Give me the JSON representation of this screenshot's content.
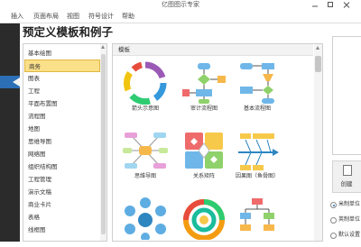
{
  "app_title": "亿图图示专家",
  "menu": [
    "插入",
    "页面布局",
    "视图",
    "符号设计",
    "帮助"
  ],
  "heading": "预定义模板和例子",
  "categories": {
    "items": [
      "基本绘图",
      "商务",
      "图表",
      "工程",
      "平面布置图",
      "流程图",
      "地图",
      "思维导图",
      "网络图",
      "组织结构图",
      "工程管理",
      "演示文稿",
      "商业卡片",
      "表格",
      "线框图"
    ],
    "selected": "商务"
  },
  "templates": {
    "header": "模板",
    "items": [
      {
        "label": "箭头示意图",
        "icon": "arrow-cycle-diagram-icon"
      },
      {
        "label": "审计流程图",
        "icon": "audit-flowchart-icon"
      },
      {
        "label": "基本流程图",
        "icon": "basic-flowchart-icon"
      },
      {
        "label": "思维导图",
        "icon": "mind-map-icon"
      },
      {
        "label": "关系矩阵",
        "icon": "relation-matrix-icon"
      },
      {
        "label": "因果图（鱼骨图）",
        "icon": "fishbone-diagram-icon"
      },
      {
        "label": "",
        "icon": "circle-network-icon"
      },
      {
        "label": "",
        "icon": "ring-diagram-icon"
      },
      {
        "label": "",
        "icon": "tree-flowchart-icon"
      }
    ]
  },
  "right_panel": {
    "create_label": "创建",
    "units": [
      {
        "label": "米制单位",
        "checked": true
      },
      {
        "label": "英制单位",
        "checked": false
      },
      {
        "label": "默认设置",
        "checked": false
      }
    ]
  },
  "colors": {
    "selected_bg": "#fbe08a",
    "accent": "#2d6fb7",
    "left_strip": "#2b2b2b"
  }
}
